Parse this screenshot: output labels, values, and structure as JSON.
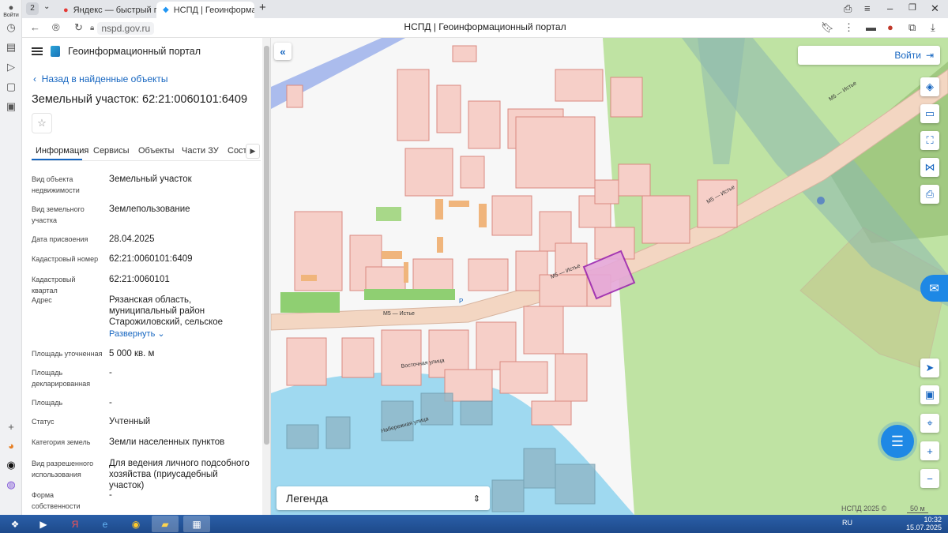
{
  "browser": {
    "tabs": [
      {
        "label": "Яндекс — быстрый поис",
        "active": false
      },
      {
        "label": "НСПД | Геоинформаци",
        "active": true
      }
    ],
    "url_host": "nspd.gov.ru",
    "page_title": "НСПД | Геоинформационный портал",
    "profile_label": "Войти",
    "tab_counter": "2"
  },
  "panel": {
    "portal_title": "Геоинформационный портал",
    "back_label": "Назад в найденные объекты",
    "object_title": "Земельный участок: 62:21:0060101:6409",
    "tabs": [
      "Информация",
      "Сервисы",
      "Объекты",
      "Части ЗУ",
      "Соста"
    ],
    "fields": [
      {
        "label": "Вид объекта недвижимости",
        "value": "Земельный участок"
      },
      {
        "label": "Вид земельного участка",
        "value": "Землепользование"
      },
      {
        "label": "Дата присвоения",
        "value": "28.04.2025"
      },
      {
        "label": "Кадастровый номер",
        "value": "62:21:0060101:6409"
      },
      {
        "label": "Кадастровый квартал",
        "value": "62:21:0060101"
      },
      {
        "label": "Адрес",
        "value": "Рязанская область, муниципальный район Старожиловский, сельское поселение Истьинское, село Истье,"
      },
      {
        "label": "Площадь уточненная",
        "value": "5 000 кв. м"
      },
      {
        "label": "Площадь декларированная",
        "value": "-"
      },
      {
        "label": "Площадь",
        "value": "-"
      },
      {
        "label": "Статус",
        "value": "Учтенный"
      },
      {
        "label": "Категория земель",
        "value": "Земли населенных пунктов"
      },
      {
        "label": "Вид разрешенного использования",
        "value": "Для ведения личного подсобного хозяйства (приусадебный участок)"
      },
      {
        "label": "Форма собственности",
        "value": "-"
      }
    ],
    "expand_label": "Развернуть"
  },
  "map": {
    "login_label": "Войти",
    "legend_label": "Легенда",
    "copyright": "НСПД 2025 ©",
    "scale": "50 м",
    "road_labels": [
      "М5 — Истье",
      "М5 — Истье",
      "М5 — Истье",
      "М5 — Истье",
      "Восточная улица",
      "Набережная улица"
    ],
    "parking_label": "P"
  },
  "taskbar": {
    "lang": "RU",
    "time": "10:32",
    "date": "15.07.2025"
  },
  "colors": {
    "accent": "#1565c0",
    "parcel_fill": "#f6cfc8",
    "parcel_stroke": "#d98a80",
    "selected_parcel": "#9c27b0",
    "green_area": "#bfe3a3",
    "water": "#9fd9f0",
    "road": "#f3d6c2"
  }
}
